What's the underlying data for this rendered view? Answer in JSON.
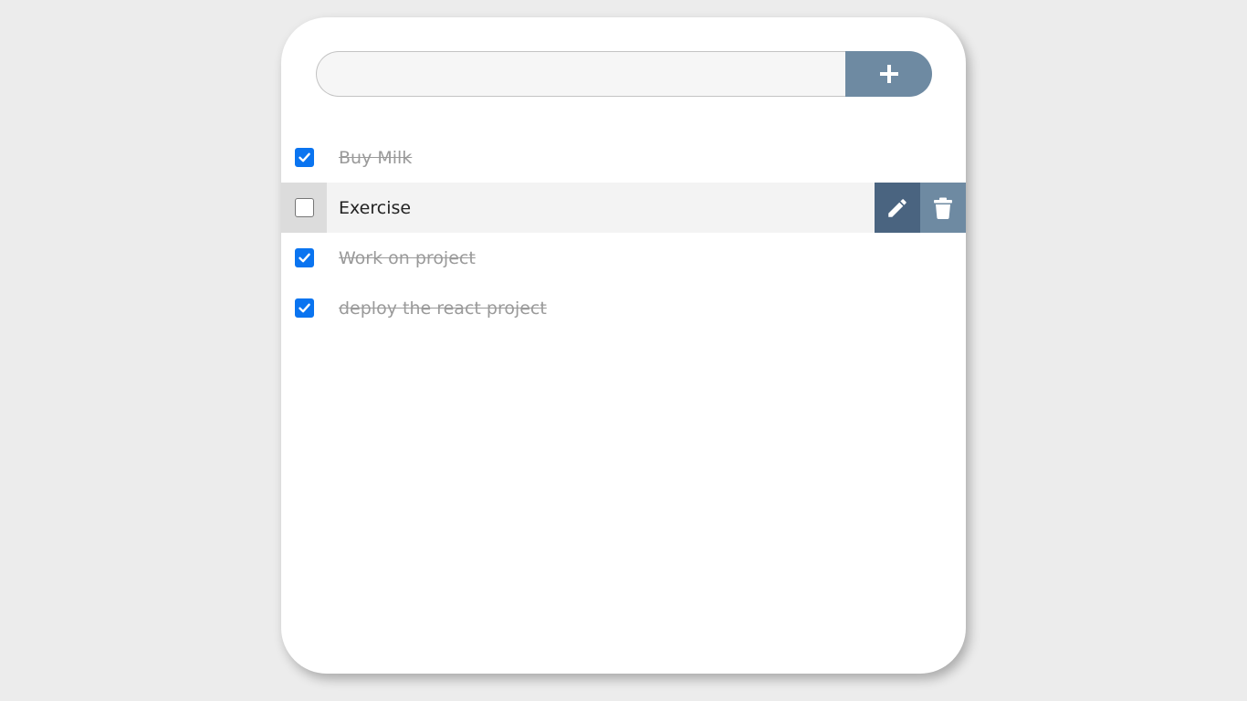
{
  "new_task": {
    "value": "",
    "placeholder": ""
  },
  "add_button": {
    "icon": "plus-icon",
    "color": "#6e8aa2"
  },
  "tasks": [
    {
      "label": "Buy Milk",
      "done": true
    },
    {
      "label": "Exercise",
      "done": false,
      "hovered": true
    },
    {
      "label": "Work on project",
      "done": true
    },
    {
      "label": "deploy the react project",
      "done": true
    }
  ],
  "row_actions": {
    "edit_icon": "pencil-icon",
    "edit_color": "#4a6480",
    "delete_icon": "trash-icon",
    "delete_color": "#6e8aa2"
  },
  "colors": {
    "checkbox_checked": "#0a74f0",
    "background": "#ececec",
    "card": "#ffffff"
  }
}
